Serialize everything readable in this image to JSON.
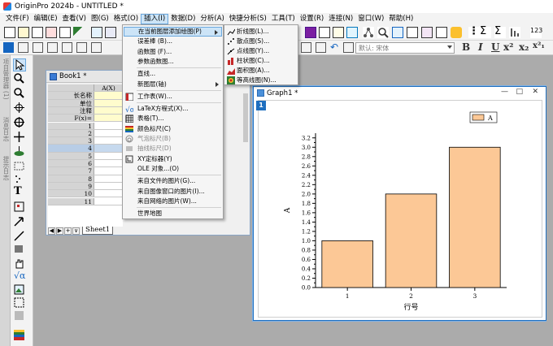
{
  "window": {
    "title": "OriginPro 2024b - UNTITLED *"
  },
  "menubar": [
    "文件(F)",
    "编辑(E)",
    "查看(V)",
    "图(G)",
    "格式(O)",
    "插入(I)",
    "数据(D)",
    "分析(A)",
    "快捷分析(S)",
    "工具(T)",
    "设置(R)",
    "连接(N)",
    "窗口(W)",
    "帮助(H)"
  ],
  "active_menu_index": 5,
  "toolbar": {
    "font_name": "默认: 宋体",
    "format_buttons": [
      "B",
      "I",
      "U",
      "x²",
      "x₂",
      "x²₁"
    ],
    "corner_label": "123"
  },
  "left_panel": {
    "labels": [
      "项目管理器 (1)",
      "消息日志",
      "提示日志"
    ]
  },
  "insert_menu": {
    "items": [
      {
        "label": "在当前图层添加绘图(P)",
        "icon": "",
        "submenu": true,
        "active": true
      },
      {
        "label": "误差棒 (B)...",
        "icon": "",
        "grey": false
      },
      {
        "label": "函数图 (F)...",
        "icon": ""
      },
      {
        "label": "参数函数图...",
        "icon": ""
      },
      {
        "sep": true
      },
      {
        "label": "直线...",
        "icon": ""
      },
      {
        "label": "新图层(轴)",
        "icon": "",
        "submenu": true
      },
      {
        "sep": true
      },
      {
        "label": "工作表(W)...",
        "icon": "worksheet-icon"
      },
      {
        "sep": true
      },
      {
        "label": "LaTeX方程式(X)...",
        "icon": "latex-icon"
      },
      {
        "label": "表格(T)...",
        "icon": "table-icon"
      },
      {
        "label": "颜色标尺(C)",
        "icon": "colorscale-icon"
      },
      {
        "label": "气泡标尺(B)",
        "icon": "bubble-icon",
        "grey": true
      },
      {
        "label": "抽线标尺(D)",
        "icon": "linescale-icon",
        "grey": true
      },
      {
        "label": "XY定标器(Y)",
        "icon": "xyscaler-icon"
      },
      {
        "label": "OLE 对象...(O)",
        "icon": ""
      },
      {
        "sep": true
      },
      {
        "label": "来自文件的图片(G)...",
        "icon": ""
      },
      {
        "label": "来自图像窗口的图片(I)...",
        "icon": ""
      },
      {
        "label": "来自网络的图片(W)...",
        "icon": ""
      },
      {
        "sep": true
      },
      {
        "label": "世界地图",
        "icon": ""
      }
    ]
  },
  "plot_submenu": {
    "items": [
      {
        "label": "折线图(L)...",
        "icon": "line-plot-icon"
      },
      {
        "label": "散点图(S)...",
        "icon": "scatter-plot-icon"
      },
      {
        "label": "点线图(Y)...",
        "icon": "line-symbol-icon"
      },
      {
        "label": "柱状图(C)...",
        "icon": "column-plot-icon"
      },
      {
        "label": "面积图(A)...",
        "icon": "area-plot-icon"
      },
      {
        "label": "等高线图(N)...",
        "icon": "contour-plot-icon"
      }
    ]
  },
  "book": {
    "title": "Book1 *",
    "column_header": "A(X)",
    "meta_rows": [
      "长名称",
      "单位",
      "注释",
      "F(x)="
    ],
    "data_rows": [
      "1",
      "2",
      "3",
      "4",
      "5",
      "6",
      "7",
      "8",
      "9",
      "10",
      "11"
    ],
    "highlight_row": 4,
    "sheet_tab": "Sheet1",
    "nav_buttons": [
      "◀",
      "▶",
      "+",
      "∨"
    ]
  },
  "graph": {
    "title": "Graph1 *",
    "layer": "1",
    "controls": [
      "—",
      "□",
      "✕"
    ]
  },
  "chart_data": {
    "type": "bar",
    "categories": [
      "1",
      "2",
      "3"
    ],
    "values": [
      1.0,
      2.0,
      3.0
    ],
    "series": [
      {
        "name": "A",
        "values": [
          1.0,
          2.0,
          3.0
        ]
      }
    ],
    "xlabel": "行号",
    "ylabel": "A",
    "ylim": [
      0,
      3.3
    ],
    "yticks": [
      "0.0",
      "0.2",
      "0.4",
      "0.6",
      "0.8",
      "1.0",
      "1.2",
      "1.4",
      "1.6",
      "1.8",
      "2.0",
      "2.2",
      "2.4",
      "2.6",
      "2.8",
      "3.0",
      "3.2"
    ],
    "bar_color": "#fcc896",
    "grid": false,
    "legend": "top-right"
  },
  "colors": {
    "accent": "#1f6fbf",
    "menu_highlight": "#cce4f7"
  }
}
